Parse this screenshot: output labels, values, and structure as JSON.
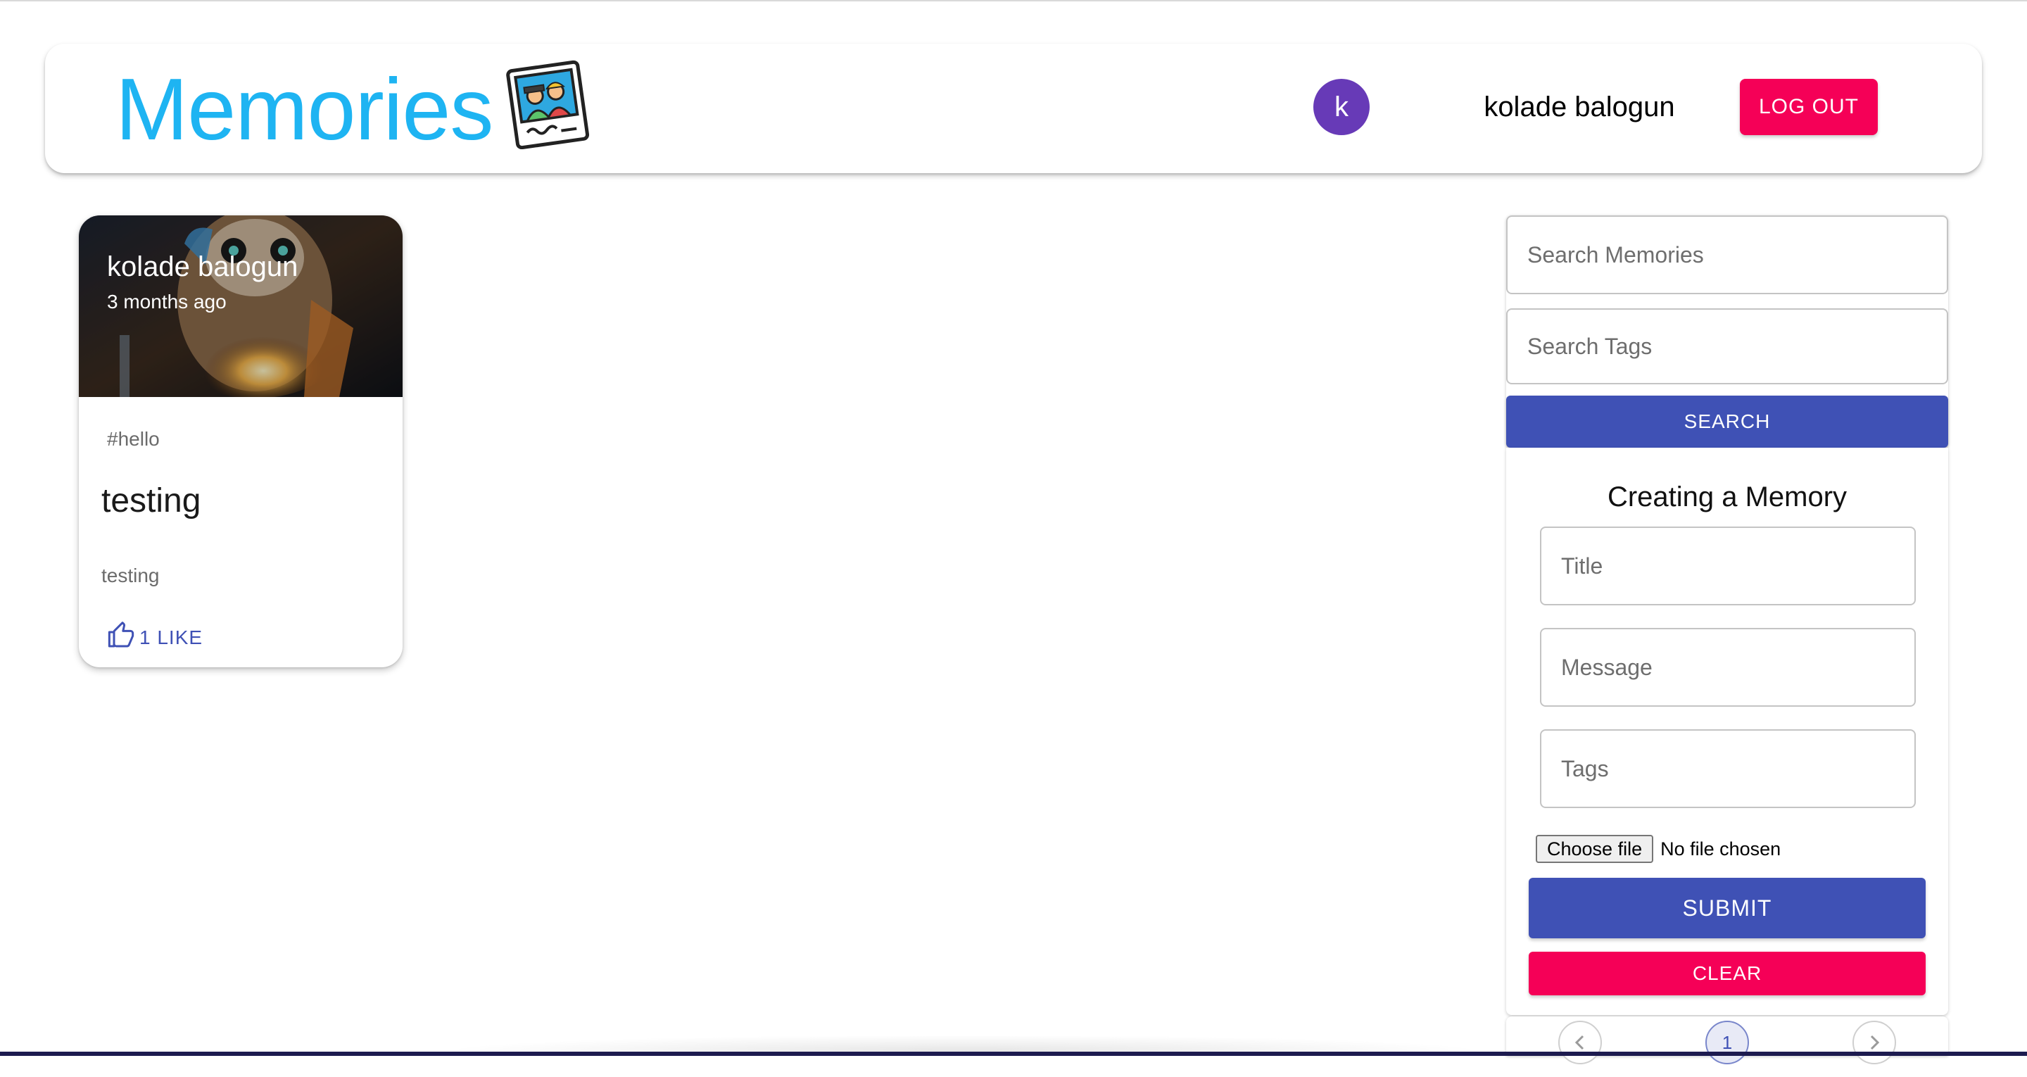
{
  "header": {
    "brand_title": "Memories",
    "brand_icon": "photo-memories-icon",
    "avatar_initial": "k",
    "user_name": "kolade balogun",
    "logout_label": "LOG OUT",
    "colors": {
      "brand": "#1eb4f2",
      "avatar": "#673ab7",
      "logout": "#f50057"
    }
  },
  "posts": [
    {
      "creator": "kolade balogun",
      "time_ago": "3 months ago",
      "tags": "#hello",
      "title": "testing",
      "message": "testing",
      "like_label": "1 LIKE",
      "like_icon": "thumb-up-icon"
    }
  ],
  "search": {
    "memories_placeholder": "Search Memories",
    "tags_placeholder": "Search Tags",
    "search_label": "SEARCH"
  },
  "form": {
    "heading": "Creating a Memory",
    "title_placeholder": "Title",
    "message_placeholder": "Message",
    "tags_placeholder": "Tags",
    "file_button_label": "Choose file",
    "file_status": "No file chosen",
    "submit_label": "SUBMIT",
    "clear_label": "CLEAR",
    "colors": {
      "primary": "#3f51b5",
      "secondary": "#f50057"
    }
  },
  "pagination": {
    "prev_icon": "chevron-left-icon",
    "current_page": "1",
    "next_icon": "chevron-right-icon"
  }
}
